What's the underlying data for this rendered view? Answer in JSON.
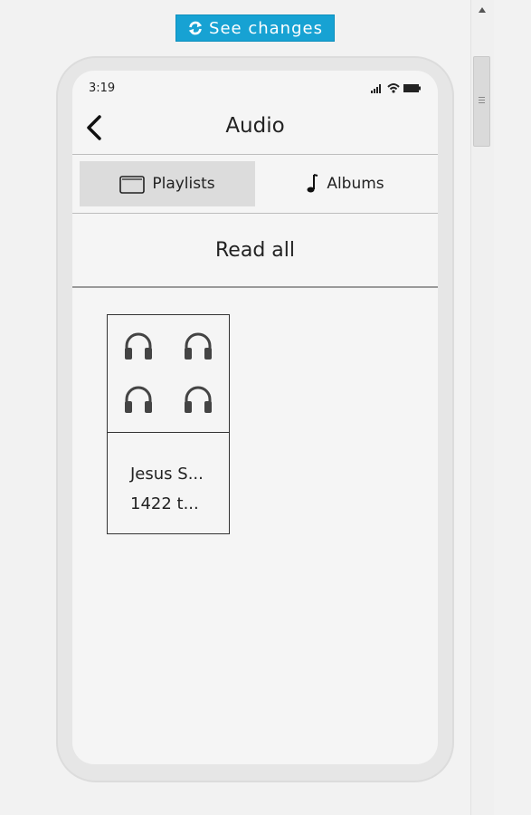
{
  "toolbar": {
    "see_changes_label": "See changes"
  },
  "status_bar": {
    "time": "3:19"
  },
  "header": {
    "title": "Audio"
  },
  "tabs": [
    {
      "label": "Playlists",
      "active": true,
      "icon": "folder-icon"
    },
    {
      "label": "Albums",
      "active": false,
      "icon": "music-note-icon"
    }
  ],
  "actions": {
    "read_all_label": "Read all"
  },
  "playlists": [
    {
      "name": "Jesus S...",
      "tracks": "1422 t..."
    }
  ],
  "colors": {
    "accent": "#17a2d3"
  }
}
